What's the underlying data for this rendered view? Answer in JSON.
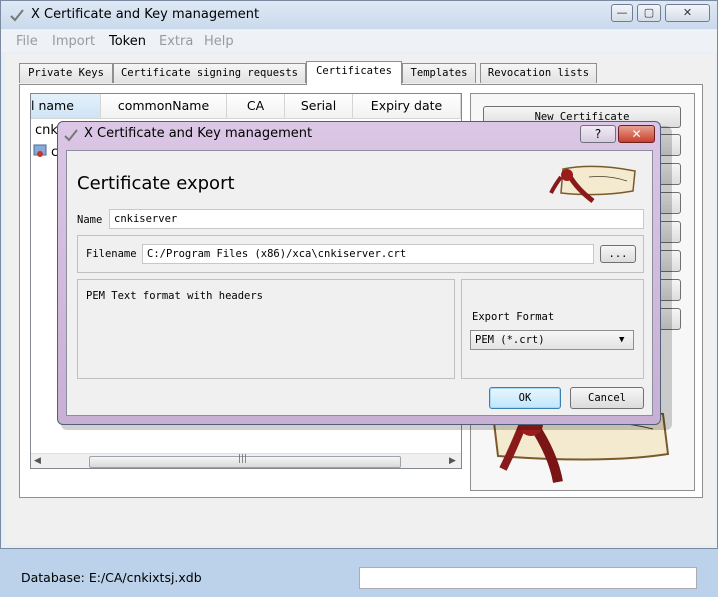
{
  "main_window": {
    "title": "X Certificate and Key management",
    "controls": {
      "minimize": "—",
      "maximize": "▢",
      "close": "✕"
    }
  },
  "menu": [
    "File",
    "Import",
    "Token",
    "Extra",
    "Help"
  ],
  "tabs": [
    "Private Keys",
    "Certificate signing requests",
    "Certificates",
    "Templates",
    "Revocation lists"
  ],
  "table": {
    "columns": [
      "l name",
      "commonName",
      "CA",
      "Serial",
      "Expiry date"
    ],
    "rows": [
      {
        "name": "cnki",
        "ca": ""
      },
      {
        "name": "c",
        "ca": "✔"
      }
    ]
  },
  "side_buttons": [
    "New Certificate"
  ],
  "status": {
    "database": "Database: E:/CA/cnkixtsj.xdb"
  },
  "dialog": {
    "title": "X Certificate and Key management",
    "heading": "Certificate export",
    "name_label": "Name",
    "name_value": "cnkiserver",
    "filename_label": "Filename",
    "filename_value": "C:/Program Files (x86)/xca\\cnkiserver.crt",
    "browse_label": "...",
    "description": "PEM Text format with headers",
    "export_format_label": "Export Format",
    "export_format_value": "PEM (*.crt)",
    "ok_label": "OK",
    "cancel_label": "Cancel",
    "help_label": "?",
    "close_label": "✕"
  }
}
